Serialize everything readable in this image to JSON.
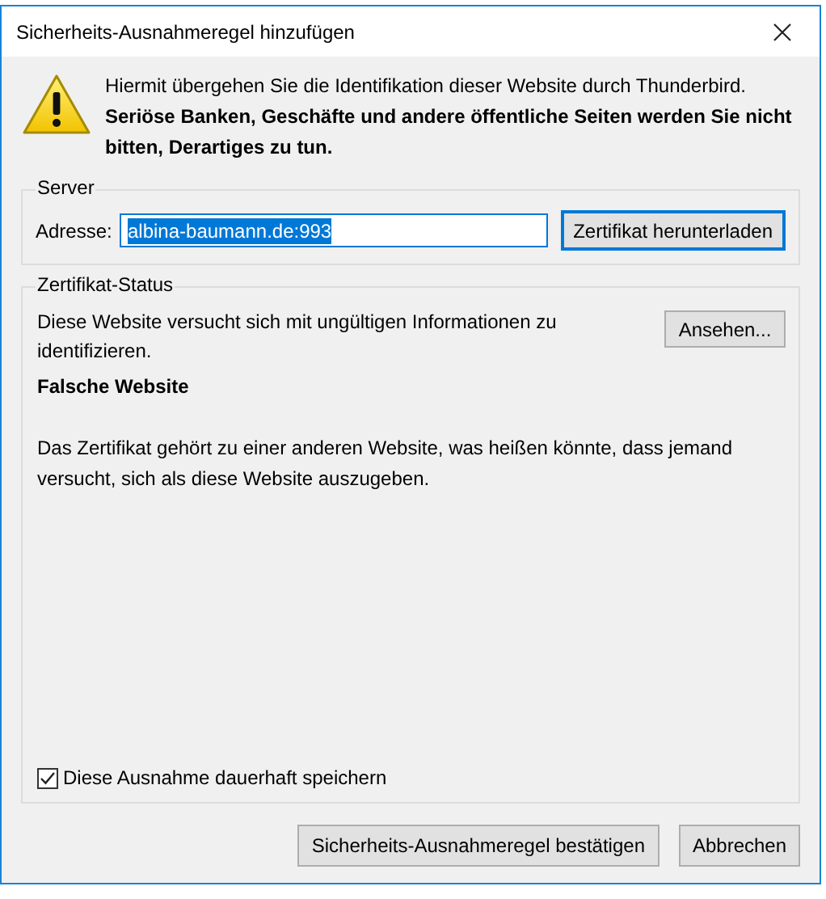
{
  "window": {
    "title": "Sicherheits-Ausnahmeregel hinzufügen"
  },
  "header": {
    "text": "Hiermit übergehen Sie die Identifikation dieser Website durch Thunderbird.",
    "warning": "Seriöse Banken, Geschäfte und andere öffentliche Seiten werden Sie nicht bitten, Derartiges zu tun."
  },
  "server": {
    "legend": "Server",
    "address_label": "Adresse:",
    "address_value": "albina-baumann.de:993",
    "value_selected": true,
    "download_button": {
      "label": "Zertifikat herunterladen",
      "focused": true
    }
  },
  "status": {
    "legend": "Zertifikat-Status",
    "text": "Diese Website versucht sich mit ungültigen Informationen zu identifizieren.",
    "view_button": "Ansehen...",
    "heading": "Falsche Website",
    "detail": "Das Zertifikat gehört zu einer anderen Website, was heißen könnte, dass jemand versucht, sich als diese Website auszugeben."
  },
  "permanent": {
    "label": "Diese Ausnahme dauerhaft speichern",
    "checked": true
  },
  "buttons": [
    {
      "label": "Sicherheits-Ausnahmeregel bestätigen"
    },
    {
      "label": "Abbrechen"
    }
  ]
}
